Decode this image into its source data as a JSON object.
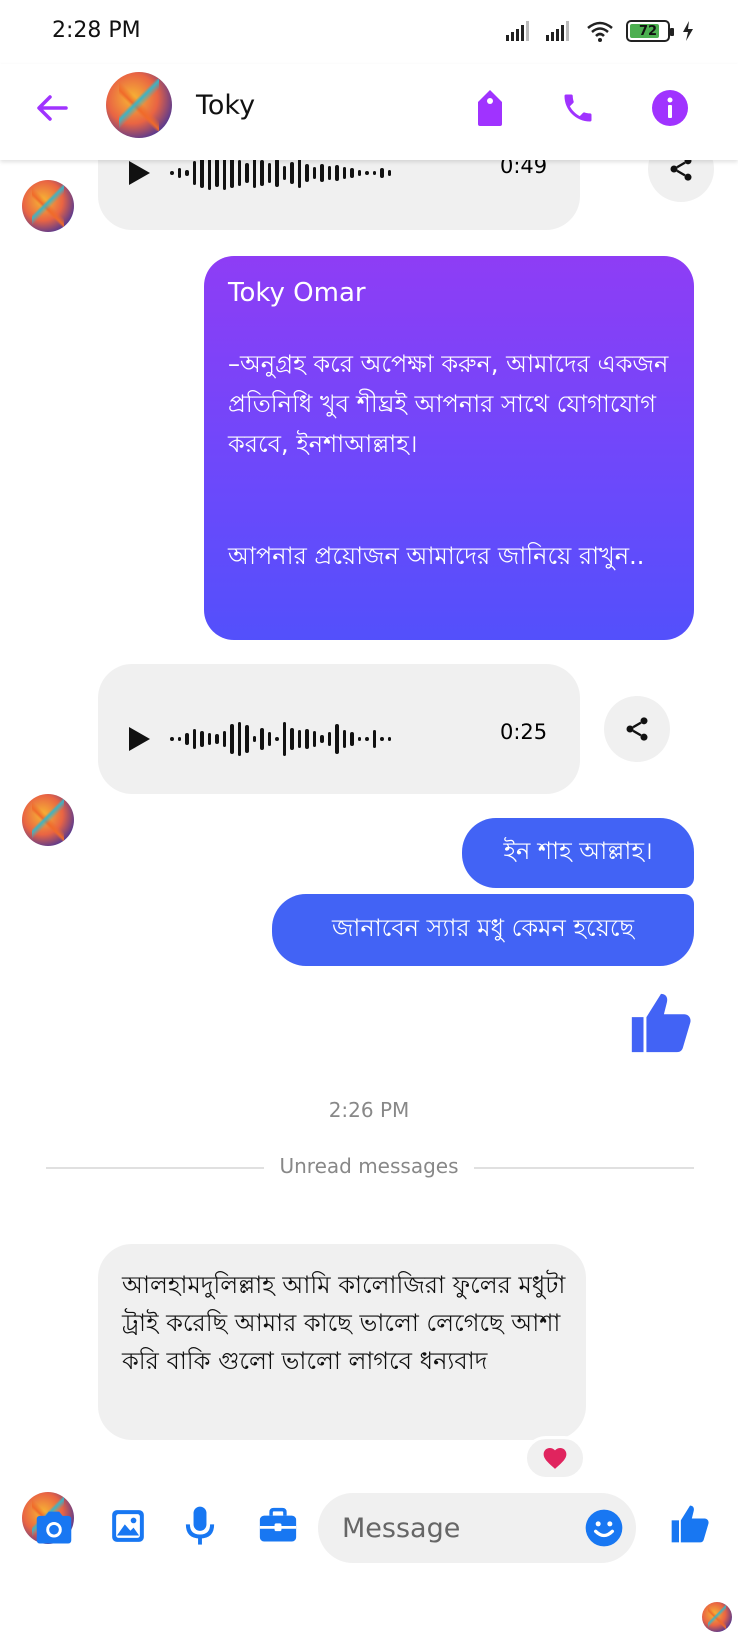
{
  "status": {
    "time": "2:28 PM",
    "battery": "72"
  },
  "header": {
    "contact_name": "Toky"
  },
  "messages": {
    "audio_1": {
      "duration": "0:49"
    },
    "card": {
      "sender": "Toky Omar",
      "paragraph_1": "–অনুগ্রহ করে অপেক্ষা করুন, আমাদের একজন প্রতিনিধি খুব শীঘ্রই আপনার সাথে যোগাযোগ করবে, ইনশাআল্লাহ।",
      "paragraph_2": "আপনার প্রয়োজন আমাদের জানিয়ে রাখুন.."
    },
    "audio_2": {
      "duration": "0:25"
    },
    "out_1": "ইন শাহ আল্লাহ।",
    "out_2": "জানাবেন স্যার মধু কেমন হয়েছে",
    "timestamp": "2:26 PM",
    "unread_divider": "Unread messages",
    "in_last": "আলহামদুলিল্লাহ আমি কালোজিরা ফুলের মধুটা ট্রাই করেছি আমার কাছে ভালো লেগেছে আশা করি বাকি গুলো ভালো লাগবে ধন্যবাদ",
    "reaction": "❤️"
  },
  "composer": {
    "placeholder": "Message"
  },
  "colors": {
    "accent_purple": "#a033ff",
    "messenger_blue": "#4263f5",
    "icon_blue": "#1877f2"
  }
}
